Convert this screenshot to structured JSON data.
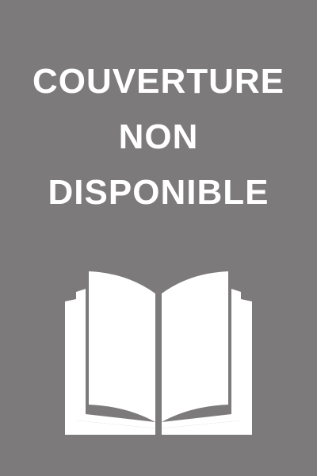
{
  "cover": {
    "title_lines": [
      "COUVERTURE",
      "NON",
      "DISPONIBLE"
    ],
    "background_color": "#7c7a7b",
    "text_color": "#ffffff",
    "icon": "open-book-icon"
  }
}
